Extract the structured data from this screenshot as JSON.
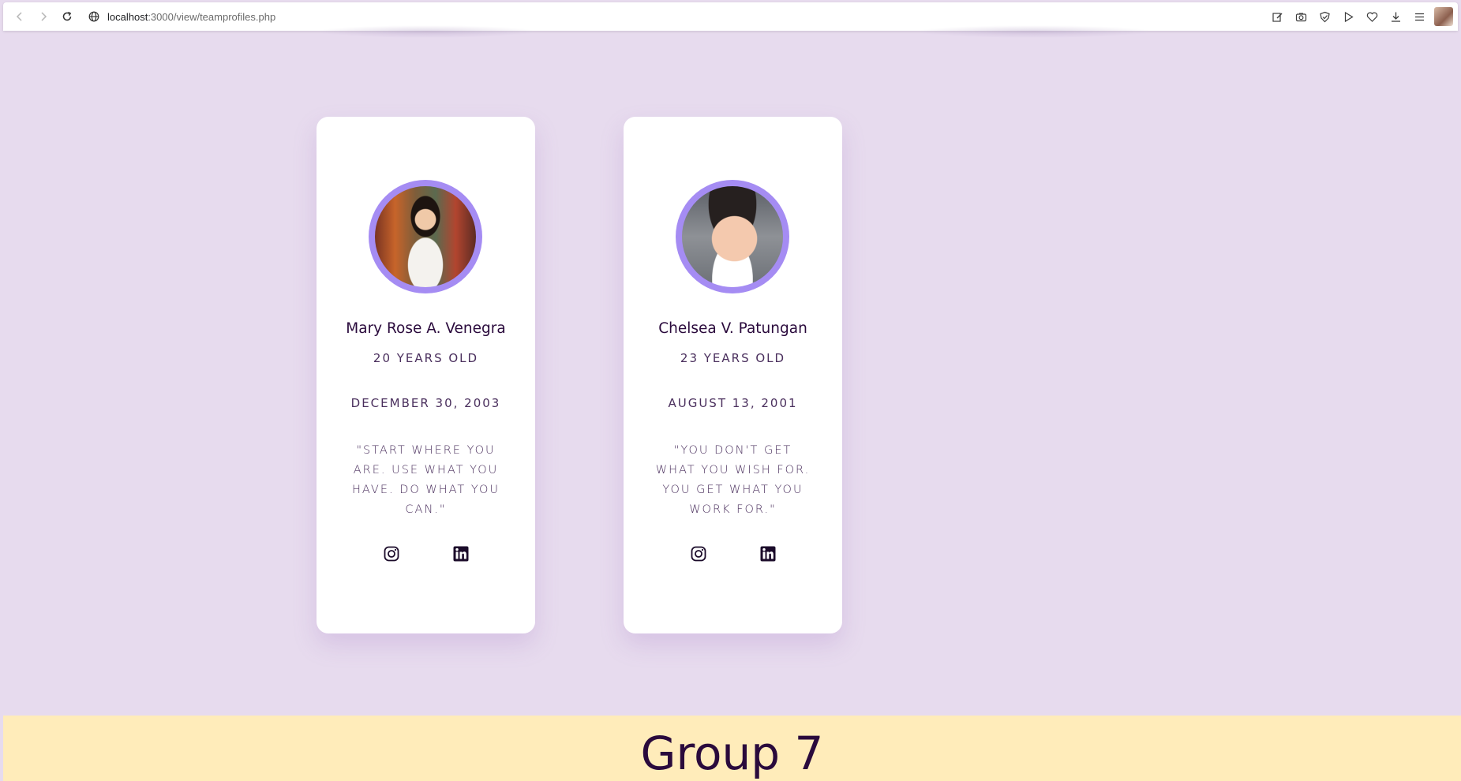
{
  "browser": {
    "url_host": "localhost",
    "url_path": ":3000/view/teamprofiles.php"
  },
  "profiles": [
    {
      "name": "Mary Rose A. Venegra",
      "age": "20 YEARS OLD",
      "birthday": "DECEMBER 30, 2003",
      "quote": "\"START WHERE YOU ARE. USE WHAT YOU HAVE. DO WHAT YOU CAN.\""
    },
    {
      "name": "Chelsea V. Patungan",
      "age": "23 YEARS OLD",
      "birthday": "AUGUST 13, 2001",
      "quote": "\"YOU DON'T GET WHAT YOU WISH FOR. YOU GET WHAT YOU WORK FOR.\""
    }
  ],
  "social_icons": [
    "instagram-icon",
    "linkedin-icon"
  ],
  "footer": {
    "title": "Group 7"
  },
  "colors": {
    "page_background": "#e7dbee",
    "card_background": "#ffffff",
    "photo_ring": "#a58cf3",
    "text_dark": "#2a0a3c",
    "footer_background": "#ffecba"
  }
}
